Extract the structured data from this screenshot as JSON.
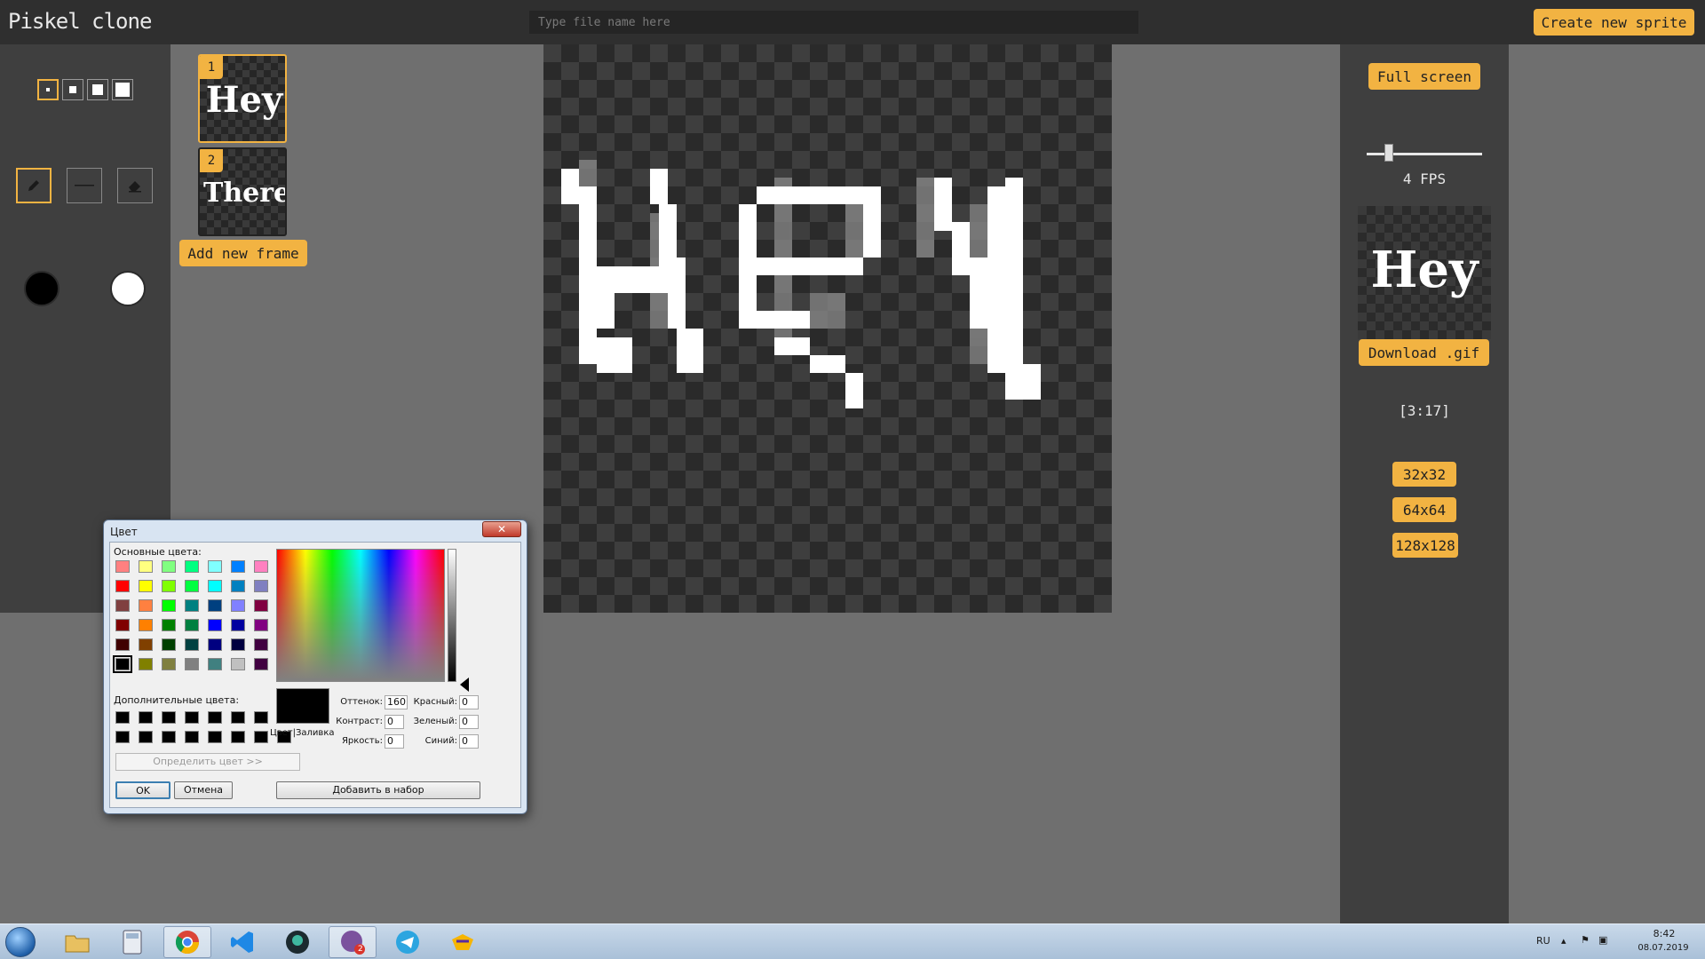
{
  "header": {
    "app_title": "Piskel clone",
    "file_input_placeholder": "Type file name here",
    "create_button": "Create new sprite"
  },
  "tools": {
    "pen_sizes": [
      "1px",
      "2px",
      "3px",
      "4px"
    ],
    "tool_icons": [
      "pencil-icon",
      "line-icon",
      "eraser-icon"
    ],
    "primary_color": "#000000",
    "secondary_color": "#ffffff"
  },
  "frames": {
    "items": [
      {
        "number": "1",
        "preview_text": "Hey"
      },
      {
        "number": "2",
        "preview_text": "There"
      }
    ],
    "add_button": "Add new frame"
  },
  "preview_panel": {
    "fullscreen_button": "Full screen",
    "fps": 4,
    "fps_label": "4 FPS",
    "preview_text": "Hey",
    "download_button": "Download .gif",
    "cursor_position": "[3:17]",
    "size_buttons": [
      "32x32",
      "64x64",
      "128x128"
    ]
  },
  "color_dialog": {
    "title": "Цвет",
    "basic_colors_label": "Основные цвета:",
    "custom_colors_label": "Дополнительные цвета:",
    "define_button": "Определить цвет >>",
    "ok_button": "OK",
    "cancel_button": "Отмена",
    "solid_label": "Цвет|Заливка",
    "add_button": "Добавить в набор",
    "hue_label": "Оттенок:",
    "sat_label": "Контраст:",
    "lum_label": "Яркость:",
    "red_label": "Красный:",
    "green_label": "Зеленый:",
    "blue_label": "Синий:",
    "hue_value": "160",
    "sat_value": "0",
    "lum_value": "0",
    "red_value": "0",
    "green_value": "0",
    "blue_value": "0",
    "basic_colors": [
      "#ff8080",
      "#ffff80",
      "#80ff80",
      "#00ff80",
      "#80ffff",
      "#0080ff",
      "#ff80c0",
      "#ff80ff",
      "#ff0000",
      "#ffff00",
      "#80ff00",
      "#00ff40",
      "#00ffff",
      "#0080c0",
      "#8080c0",
      "#ff00ff",
      "#804040",
      "#ff8040",
      "#00ff00",
      "#008080",
      "#004080",
      "#8080ff",
      "#800040",
      "#ff0080",
      "#800000",
      "#ff8000",
      "#008000",
      "#008040",
      "#0000ff",
      "#0000a0",
      "#800080",
      "#8000ff",
      "#400000",
      "#804000",
      "#004000",
      "#004040",
      "#000080",
      "#000040",
      "#400040",
      "#400080",
      "#000000",
      "#808000",
      "#808040",
      "#808080",
      "#408080",
      "#c0c0c0",
      "#400040",
      "#ffffff"
    ],
    "custom_colors": [
      "#000000",
      "#000000",
      "#000000",
      "#000000",
      "#000000",
      "#000000",
      "#000000",
      "#000000",
      "#000000",
      "#000000",
      "#000000",
      "#000000",
      "#000000",
      "#000000",
      "#000000",
      "#000000"
    ]
  },
  "taskbar": {
    "apps": [
      "file-explorer-icon",
      "calculator-icon",
      "chrome-icon",
      "vscode-icon",
      "gitkraken-icon",
      "viber-icon",
      "telegram-icon",
      "winamp-icon"
    ],
    "viber_badge": "2",
    "language": "RU",
    "time": "8:42",
    "date": "08.07.2019"
  }
}
